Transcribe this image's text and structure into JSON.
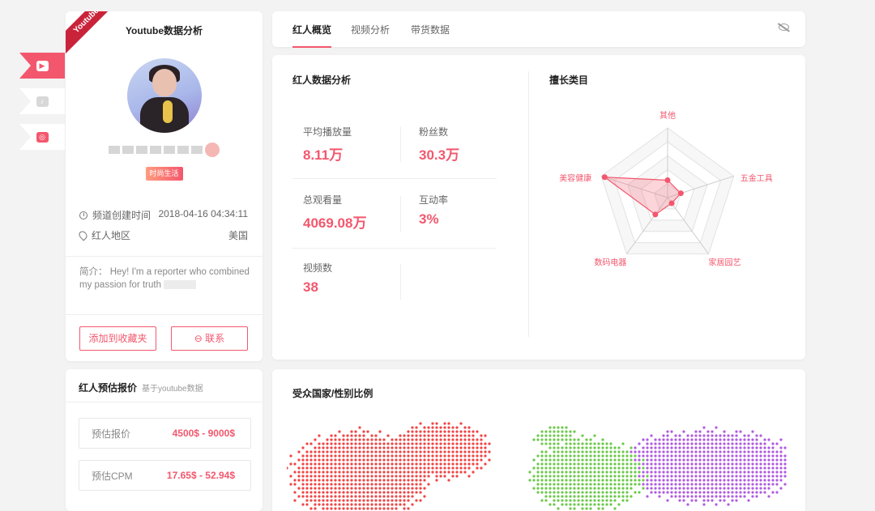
{
  "platforms": [
    {
      "name": "youtube",
      "icon": "youtube-icon",
      "active": true
    },
    {
      "name": "tiktok",
      "icon": "tiktok-icon",
      "active": false
    },
    {
      "name": "instagram",
      "icon": "instagram-icon",
      "active": false
    }
  ],
  "profile": {
    "ribbon": "Youtube",
    "title": "Youtube数据分析",
    "tag": "时尚生活",
    "created_label": "频道创建时间",
    "created_value": "2018-04-16 04:34:11",
    "region_label": "红人地区",
    "region_value": "美国",
    "bio_prefix": "简介：",
    "bio_text": "Hey! I'm a reporter who combined my passion for truth",
    "btn_favorite": "添加到收藏夹",
    "btn_contact": "⊖ 联系"
  },
  "price": {
    "title": "红人预估报价",
    "subtitle": "基于youtube数据",
    "items": [
      {
        "label": "预估报价",
        "value": "4500$ - 9000$"
      },
      {
        "label": "预估CPM",
        "value": "17.65$ - 52.94$"
      }
    ]
  },
  "tabs": [
    {
      "label": "红人概览",
      "active": true
    },
    {
      "label": "视频分析",
      "active": false
    },
    {
      "label": "带货数据",
      "active": false
    }
  ],
  "analysis": {
    "title": "红人数据分析",
    "stats": [
      {
        "label": "平均播放量",
        "value": "8.11万"
      },
      {
        "label": "粉丝数",
        "value": "30.3万"
      },
      {
        "label": "总观看量",
        "value": "4069.08万"
      },
      {
        "label": "互动率",
        "value": "3%"
      },
      {
        "label": "视频数",
        "value": "38"
      }
    ]
  },
  "categories": {
    "title": "擅长类目",
    "axes": [
      "其他",
      "五金工具",
      "家居园艺",
      "数码电器",
      "美容健康"
    ],
    "values": [
      0.25,
      0.2,
      0.1,
      0.3,
      0.95
    ],
    "accent": "#f3576d"
  },
  "audience": {
    "title": "受众国家/性别比例",
    "colors": [
      "#f04545",
      "#6cc94a",
      "#b05be0"
    ]
  }
}
